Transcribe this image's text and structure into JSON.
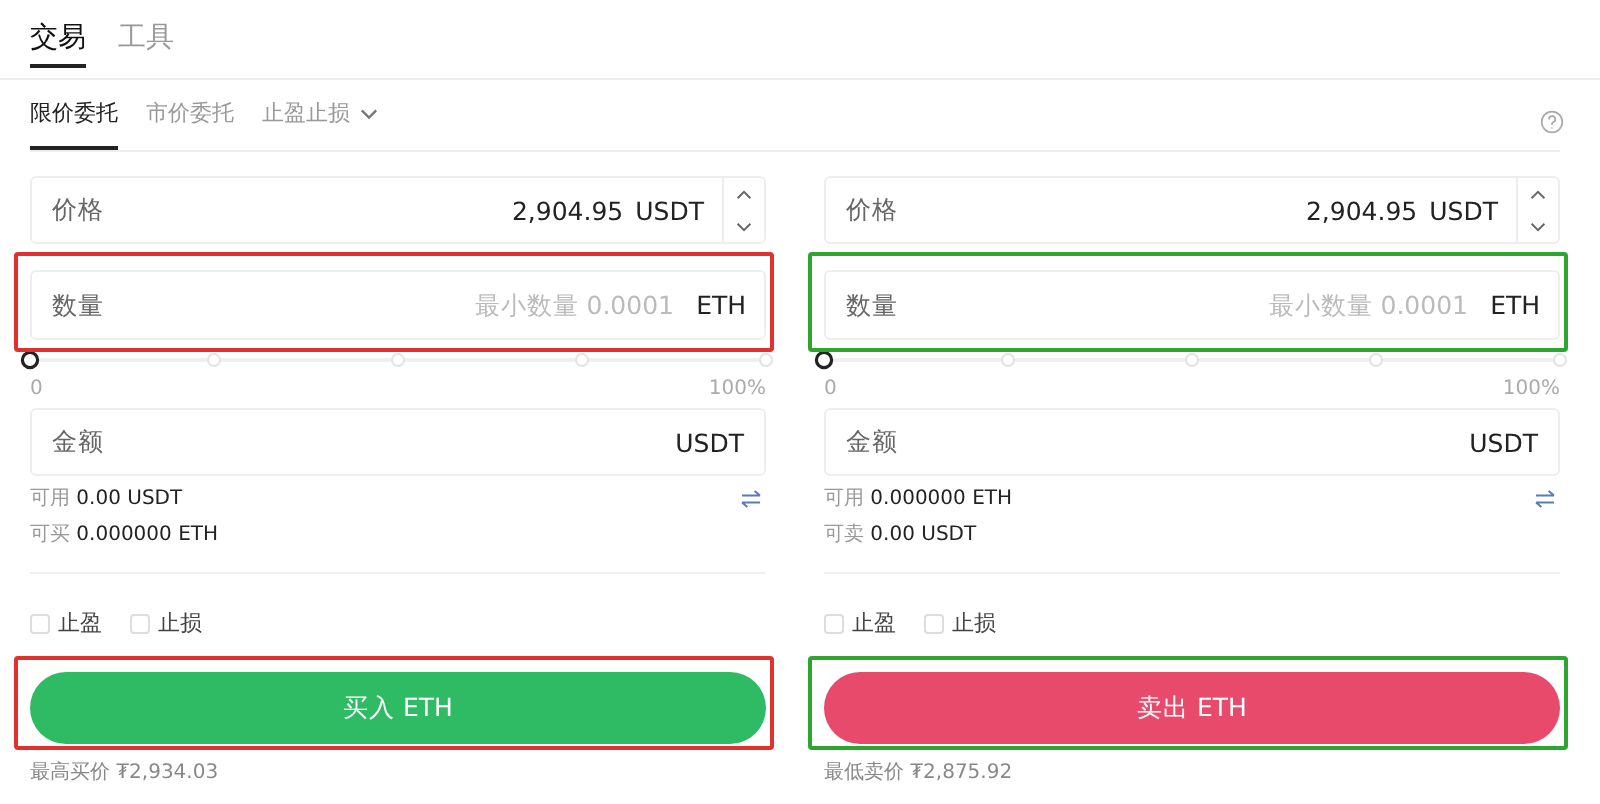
{
  "tabs": [
    {
      "label": "交易",
      "selected": true
    },
    {
      "label": "工具",
      "selected": false
    }
  ],
  "order_types": [
    {
      "label": "限价委托",
      "selected": true,
      "dropdown": false
    },
    {
      "label": "市价委托",
      "selected": false,
      "dropdown": false
    },
    {
      "label": "止盈止损",
      "selected": false,
      "dropdown": true
    }
  ],
  "panels": [
    {
      "kind": "buy",
      "color": "#e0312f",
      "price": {
        "label": "价格",
        "value": "2,904.95",
        "unit": "USDT"
      },
      "quantity": {
        "label": "数量",
        "placeholder": "最小数量 0.0001",
        "unit": "ETH"
      },
      "slider": {
        "level": 0,
        "min_label": "0",
        "max_label": "100%"
      },
      "amount": {
        "label": "金额",
        "unit": "USDT"
      },
      "balances": [
        {
          "label": "可用",
          "value": "0.00 USDT"
        },
        {
          "label": "可买",
          "value": "0.000000 ETH"
        }
      ],
      "checkboxes": [
        {
          "label": "止盈",
          "checked": false
        },
        {
          "label": "止损",
          "checked": false
        }
      ],
      "button": "买入 ETH",
      "best_price": {
        "label": "最高买价",
        "value": "₮2,934.03"
      }
    },
    {
      "kind": "sell",
      "color": "#2ea52e",
      "price": {
        "label": "价格",
        "value": "2,904.95",
        "unit": "USDT"
      },
      "quantity": {
        "label": "数量",
        "placeholder": "最小数量 0.0001",
        "unit": "ETH"
      },
      "slider": {
        "level": 0,
        "min_label": "0",
        "max_label": "100%"
      },
      "amount": {
        "label": "金额",
        "unit": "USDT"
      },
      "balances": [
        {
          "label": "可用",
          "value": "0.000000 ETH"
        },
        {
          "label": "可卖",
          "value": "0.00 USDT"
        }
      ],
      "checkboxes": [
        {
          "label": "止盈",
          "checked": false
        },
        {
          "label": "止损",
          "checked": false
        }
      ],
      "button": "卖出 ETH",
      "best_price": {
        "label": "最低卖价",
        "value": "₮2,875.92"
      }
    }
  ]
}
